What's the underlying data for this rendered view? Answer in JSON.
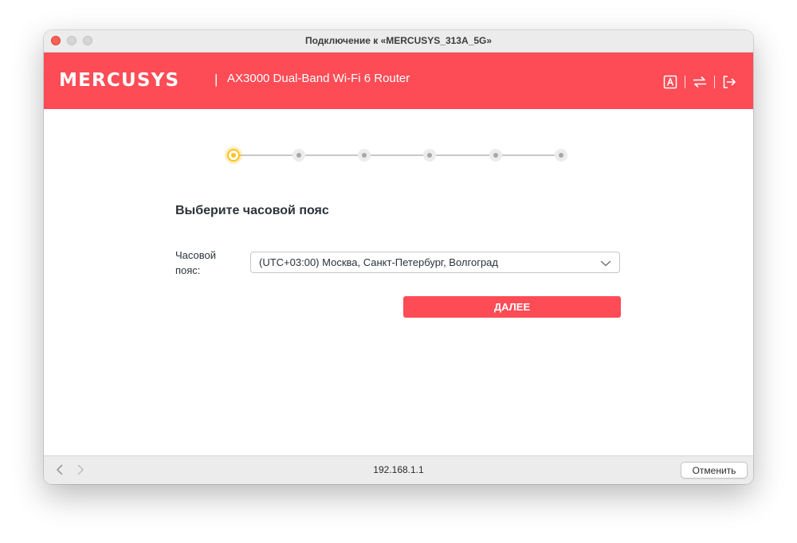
{
  "window": {
    "title": "Подключение к «MERCUSYS_313A_5G»"
  },
  "header": {
    "brand": "MERCUSYS",
    "separator": "|",
    "model": "AX3000 Dual-Band Wi-Fi 6 Router",
    "background_color": "#fd4c56",
    "icons": [
      "language-icon",
      "connection-icon",
      "logout-icon"
    ]
  },
  "stepper": {
    "total_steps": 6,
    "current_step": 1,
    "active_color": "#ffc11d"
  },
  "form": {
    "title": "Выберите часовой пояс",
    "timezone_label": "Часовой пояс:",
    "timezone_value": "(UTC+03:00) Москва, Санкт-Петербург, Волгоград",
    "next_label": "ДАЛЕЕ"
  },
  "bottom_bar": {
    "url": "192.168.1.1",
    "cancel_label": "Отменить"
  }
}
